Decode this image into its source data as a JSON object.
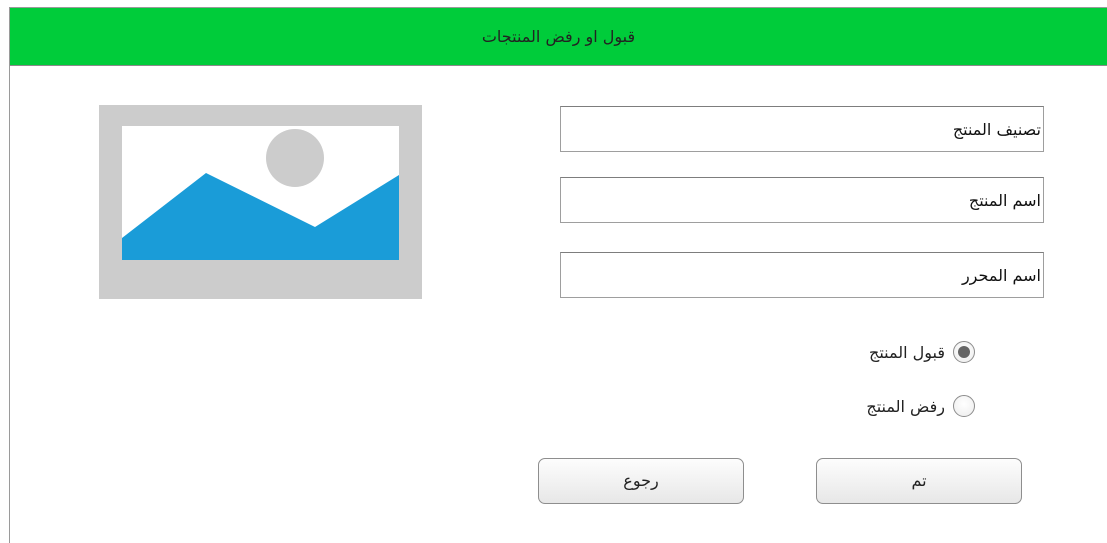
{
  "header": {
    "title": "قبول او رفض المنتجات"
  },
  "fields": {
    "category": {
      "placeholder": "تصنيف المنتج"
    },
    "product_name": {
      "placeholder": "اسم المنتج"
    },
    "editor_name": {
      "placeholder": "اسم المحرر"
    }
  },
  "image_placeholder": {
    "icon": "image-placeholder-icon"
  },
  "decision": {
    "accept_label": "قبول المنتج",
    "reject_label": "رفض المنتج",
    "selected": "accept"
  },
  "buttons": {
    "done_label": "تم",
    "back_label": "رجوع"
  },
  "colors": {
    "header": "#00cc3a",
    "image_bg": "#cccccc",
    "image_sky": "#ffffff",
    "image_mountain": "#1a9cd8",
    "image_sun": "#cccccc"
  }
}
